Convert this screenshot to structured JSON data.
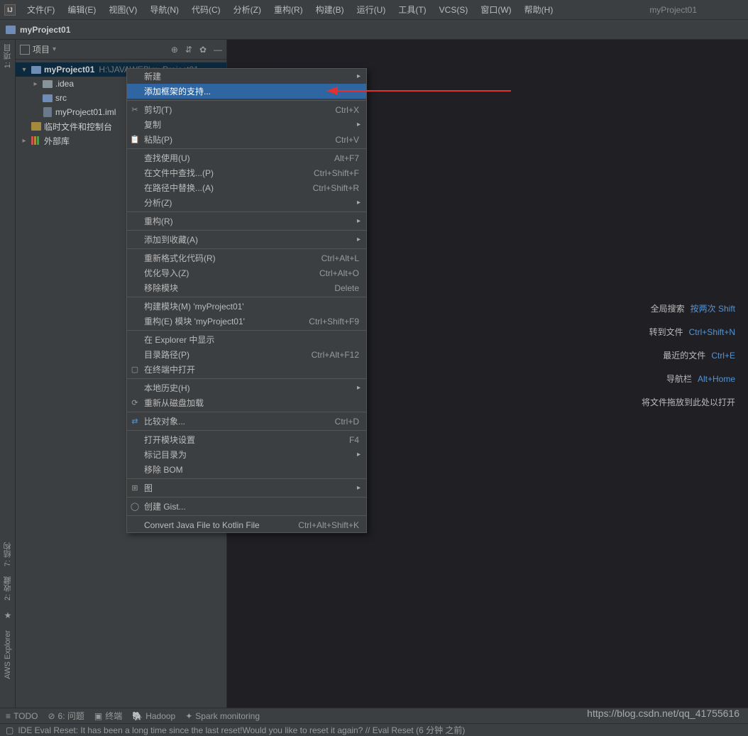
{
  "menubar": {
    "items": [
      "文件(F)",
      "编辑(E)",
      "视图(V)",
      "导航(N)",
      "代码(C)",
      "分析(Z)",
      "重构(R)",
      "构建(B)",
      "运行(U)",
      "工具(T)",
      "VCS(S)",
      "窗口(W)",
      "帮助(H)"
    ],
    "title": "myProject01"
  },
  "breadcrumb": {
    "project": "myProject01"
  },
  "sidebar": {
    "title": "项目",
    "root": {
      "name": "myProject01",
      "path": "H:\\JAVAWEB\\myProject01"
    },
    "idea": ".idea",
    "src": "src",
    "iml": "myProject01.iml",
    "scratch": "临时文件和控制台",
    "external": "外部库"
  },
  "left_tabs": {
    "project": "1: 项目"
  },
  "left_tabs_bottom": {
    "structure": "7: 结构",
    "favorites": "2: 收藏",
    "aws": "AWS Explorer"
  },
  "context": {
    "new": "新建",
    "add_framework": "添加框架的支持...",
    "cut": "剪切(T)",
    "cut_sc": "Ctrl+X",
    "copy": "复制",
    "paste": "粘贴(P)",
    "paste_sc": "Ctrl+V",
    "find_usages": "查找使用(U)",
    "find_usages_sc": "Alt+F7",
    "find_in_files": "在文件中查找...(P)",
    "find_in_files_sc": "Ctrl+Shift+F",
    "replace_in_path": "在路径中替换...(A)",
    "replace_in_path_sc": "Ctrl+Shift+R",
    "analyze": "分析(Z)",
    "refactor": "重构(R)",
    "add_to_fav": "添加到收藏(A)",
    "reformat": "重新格式化代码(R)",
    "reformat_sc": "Ctrl+Alt+L",
    "optimize": "优化导入(Z)",
    "optimize_sc": "Ctrl+Alt+O",
    "remove_module": "移除模块",
    "remove_module_sc": "Delete",
    "build_module": "构建模块(M) 'myProject01'",
    "rebuild_module": "重构(E) 模块 'myProject01'",
    "rebuild_module_sc": "Ctrl+Shift+F9",
    "show_explorer": "在 Explorer 中显示",
    "dir_path": "目录路径(P)",
    "dir_path_sc": "Ctrl+Alt+F12",
    "open_terminal": "在终端中打开",
    "local_history": "本地历史(H)",
    "reload_disk": "重新从磁盘加载",
    "compare": "比较对象...",
    "compare_sc": "Ctrl+D",
    "module_settings": "打开模块设置",
    "module_settings_sc": "F4",
    "mark_dir": "标记目录为",
    "remove_bom": "移除 BOM",
    "diagrams": "图",
    "create_gist": "创建 Gist...",
    "convert_kotlin": "Convert Java File to Kotlin File",
    "convert_kotlin_sc": "Ctrl+Alt+Shift+K"
  },
  "tips": {
    "search": "全局搜索",
    "search_kb": "按两次 Shift",
    "goto_file": "转到文件",
    "goto_file_kb": "Ctrl+Shift+N",
    "recent": "最近的文件",
    "recent_kb": "Ctrl+E",
    "navbar": "导航栏",
    "navbar_kb": "Alt+Home",
    "drop": "将文件拖放到此处以打开"
  },
  "toolbar_bottom": {
    "todo": "TODO",
    "problems": "6: 问题",
    "terminal": "终端",
    "hadoop": "Hadoop",
    "spark": "Spark monitoring"
  },
  "status": "IDE Eval Reset: It has been a long time since the last reset!Would you like to reset it again? // Eval Reset (6 分钟 之前)",
  "watermark": "https://blog.csdn.net/qq_41755616"
}
